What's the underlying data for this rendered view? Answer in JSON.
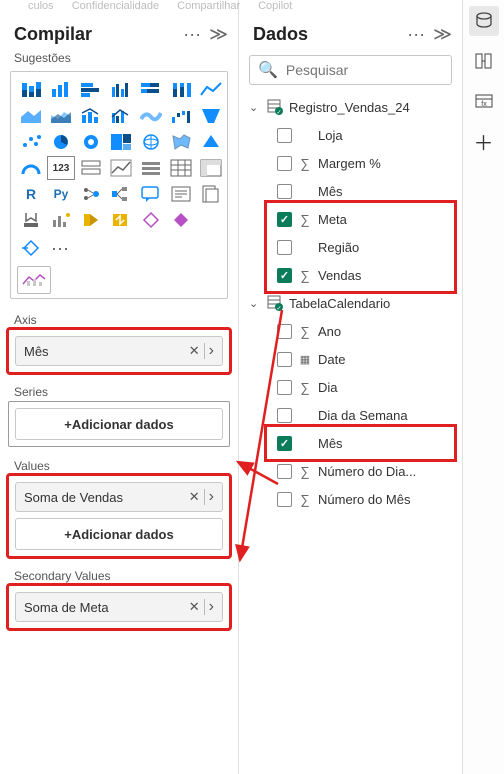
{
  "topmenu": [
    "culos",
    "Confidencialidade",
    "Compartilhar",
    "Copilot"
  ],
  "compile": {
    "title": "Compilar",
    "suggestions": "Sugestões",
    "more_glyph": "···",
    "expand_glyph": "≫"
  },
  "wells": {
    "axis": {
      "label": "Axis",
      "items": [
        "Mês"
      ]
    },
    "series": {
      "label": "Series",
      "add": "+Adicionar dados"
    },
    "values": {
      "label": "Values",
      "items": [
        "Soma de Vendas"
      ],
      "add": "+Adicionar dados"
    },
    "secondary": {
      "label": "Secondary Values",
      "items": [
        "Soma de Meta"
      ]
    }
  },
  "dados": {
    "title": "Dados",
    "search_placeholder": "Pesquisar",
    "tables": [
      {
        "name": "Registro_Vendas_24",
        "fields": [
          {
            "name": "Loja",
            "checked": false,
            "sigma": false
          },
          {
            "name": "Margem %",
            "checked": false,
            "sigma": true
          },
          {
            "name": "Mês",
            "checked": false,
            "sigma": false
          },
          {
            "name": "Meta",
            "checked": true,
            "sigma": true
          },
          {
            "name": "Região",
            "checked": false,
            "sigma": false
          },
          {
            "name": "Vendas",
            "checked": true,
            "sigma": true
          }
        ]
      },
      {
        "name": "TabelaCalendario",
        "fields": [
          {
            "name": "Ano",
            "checked": false,
            "sigma": true
          },
          {
            "name": "Date",
            "checked": false,
            "sigma": false,
            "special": "date"
          },
          {
            "name": "Dia",
            "checked": false,
            "sigma": true
          },
          {
            "name": "Dia da Semana",
            "checked": false,
            "sigma": false
          },
          {
            "name": "Mês",
            "checked": true,
            "sigma": false
          },
          {
            "name": "Número do Dia...",
            "checked": false,
            "sigma": true
          },
          {
            "name": "Número do Mês",
            "checked": false,
            "sigma": true
          }
        ]
      }
    ]
  },
  "glyphs": {
    "close": "✕",
    "chevr": "›",
    "chevd": "⌄",
    "search": "⌕",
    "check": "✓",
    "plus": "＋"
  },
  "highlight_color": "#e02020"
}
